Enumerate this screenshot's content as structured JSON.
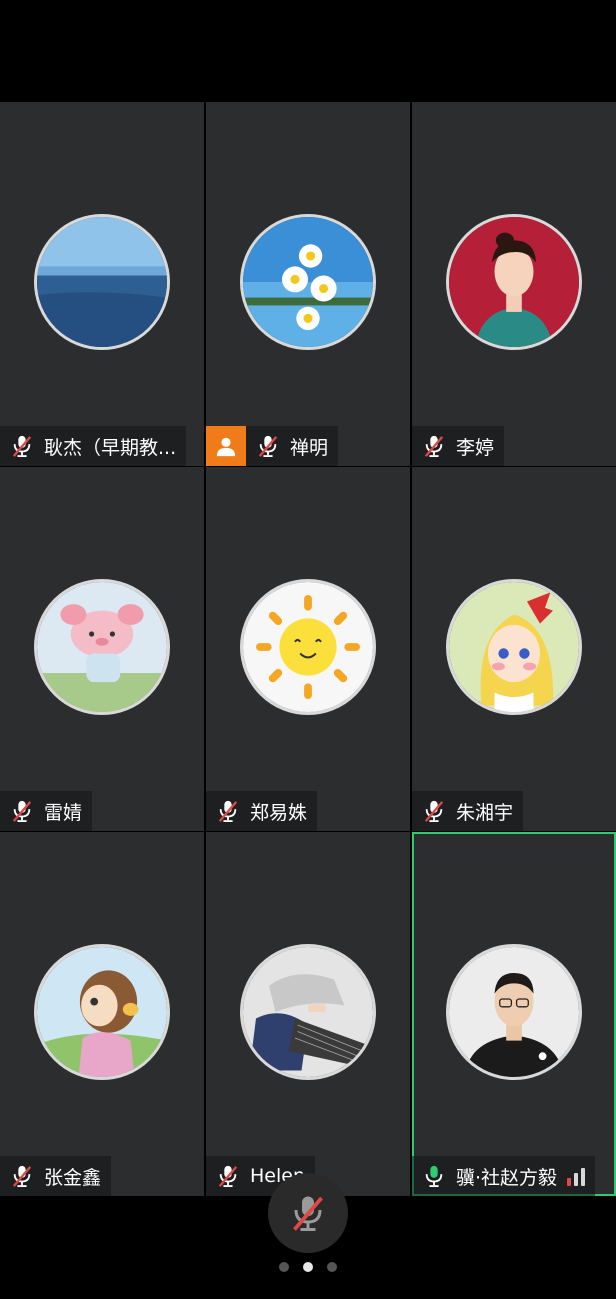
{
  "participants": [
    {
      "name": "耿杰（早期教...",
      "mic": "muted",
      "host": false,
      "active": false,
      "avatar": "ocean-avatar"
    },
    {
      "name": "禅明",
      "mic": "muted",
      "host": true,
      "active": false,
      "avatar": "daisy-avatar"
    },
    {
      "name": "李婷",
      "mic": "muted",
      "host": false,
      "active": false,
      "avatar": "woman-portrait-avatar"
    },
    {
      "name": "雷婧",
      "mic": "muted",
      "host": false,
      "active": false,
      "avatar": "pig-cartoon-avatar"
    },
    {
      "name": "郑易姝",
      "mic": "muted",
      "host": false,
      "active": false,
      "avatar": "sun-cartoon-avatar"
    },
    {
      "name": "朱湘宇",
      "mic": "muted",
      "host": false,
      "active": false,
      "avatar": "anime-girl-avatar"
    },
    {
      "name": "张金鑫",
      "mic": "muted",
      "host": false,
      "active": false,
      "avatar": "girl-cartoon-avatar"
    },
    {
      "name": "Helen",
      "mic": "muted",
      "host": false,
      "active": false,
      "avatar": "guzheng-avatar"
    },
    {
      "name": "骥·社赵方毅",
      "mic": "on",
      "host": false,
      "active": true,
      "avatar": "man-portrait-avatar"
    }
  ],
  "colors": {
    "tile_bg": "#2b2d2f",
    "host_badge": "#f07b19",
    "active_border": "#2ecc71",
    "mic_muted": "#e04848",
    "mic_on": "#2ecc71"
  },
  "pager": {
    "pages": 3,
    "current": 2
  },
  "controls": {
    "mic_button": "muted-mic-icon"
  }
}
